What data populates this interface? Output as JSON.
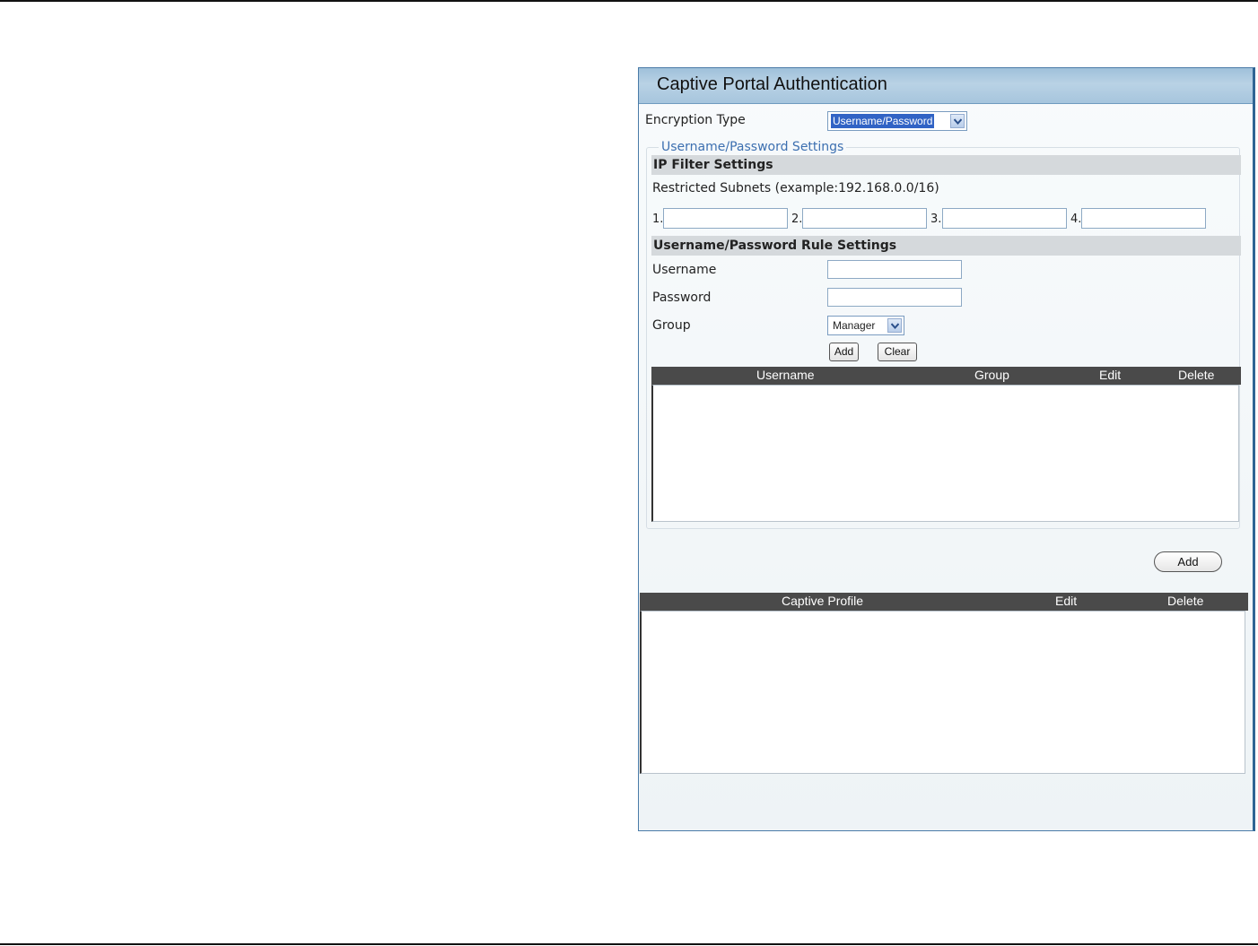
{
  "panel": {
    "title": "Captive Portal Authentication"
  },
  "encryption": {
    "label": "Encryption Type",
    "selected": "Username/Password"
  },
  "settings": {
    "legend": "Username/Password Settings",
    "ip_filter": {
      "heading": "IP Filter Settings",
      "hint": "Restricted Subnets (example:192.168.0.0/16)",
      "numbers": [
        "1.",
        "2.",
        "3.",
        "4."
      ],
      "values": [
        "",
        "",
        "",
        ""
      ]
    },
    "rules": {
      "heading": "Username/Password Rule Settings",
      "username_label": "Username",
      "username_value": "",
      "password_label": "Password",
      "password_value": "",
      "group_label": "Group",
      "group_selected": "Manager",
      "add_label": "Add",
      "clear_label": "Clear"
    },
    "user_table": {
      "columns": [
        "Username",
        "Group",
        "Edit",
        "Delete"
      ],
      "rows": []
    }
  },
  "profile_add_label": "Add",
  "profile_table": {
    "columns": [
      "Captive Profile",
      "Edit",
      "Delete"
    ],
    "rows": []
  },
  "icons": {
    "dropdown": "chevron-down-icon"
  },
  "colors": {
    "header": "#b0cbe0",
    "grid_header": "#4a4a4a",
    "selection": "#3163c5",
    "legend": "#3c6fb0"
  }
}
